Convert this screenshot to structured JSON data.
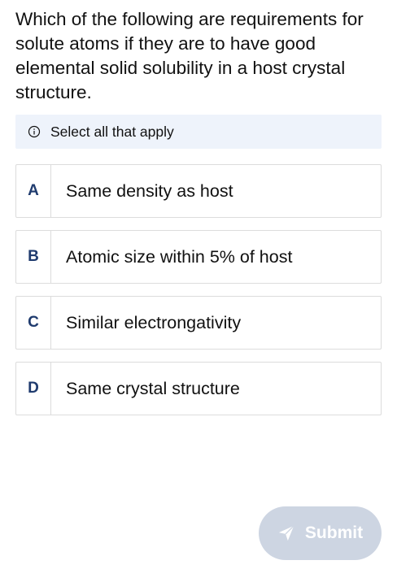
{
  "question": {
    "text": "Which of the following are requirements for solute atoms if they are to have good elemental solid solubility in a host crystal structure."
  },
  "hint": {
    "icon": "info-icon",
    "text": "Select all that apply"
  },
  "options": [
    {
      "letter": "A",
      "text": "Same density as host"
    },
    {
      "letter": "B",
      "text": "Atomic size within 5% of host"
    },
    {
      "letter": "C",
      "text": "Similar electrongativity"
    },
    {
      "letter": "D",
      "text": "Same crystal structure"
    }
  ],
  "submit": {
    "label": "Submit",
    "icon": "send-icon",
    "disabled": true
  },
  "colors": {
    "hint_bg": "#eef3fb",
    "letter": "#1f3b6e",
    "submit_bg": "#cdd5e2"
  }
}
